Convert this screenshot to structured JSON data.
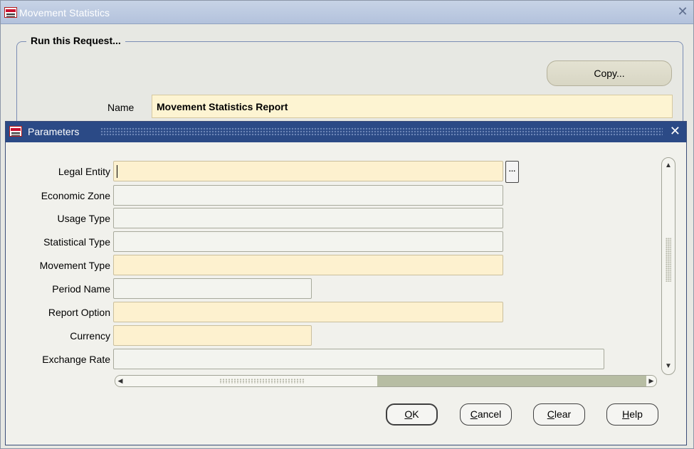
{
  "window": {
    "title": "Movement Statistics",
    "close_glyph": "✕"
  },
  "request": {
    "group_title": "Run this Request...",
    "copy_label": "Copy...",
    "name_label": "Name",
    "name_value": "Movement Statistics Report"
  },
  "parameters": {
    "title": "Parameters",
    "close_glyph": "✕",
    "fields": [
      {
        "label": "Legal Entity",
        "value": "",
        "required": true
      },
      {
        "label": "Economic Zone",
        "value": "",
        "required": false
      },
      {
        "label": "Usage Type",
        "value": "",
        "required": false
      },
      {
        "label": "Statistical Type",
        "value": "",
        "required": false
      },
      {
        "label": "Movement Type",
        "value": "",
        "required": true
      },
      {
        "label": "Period Name",
        "value": "",
        "required": false
      },
      {
        "label": "Report Option",
        "value": "",
        "required": true
      },
      {
        "label": "Currency",
        "value": "",
        "required": true
      },
      {
        "label": "Exchange Rate",
        "value": "",
        "required": false
      }
    ],
    "lov_glyph": "…",
    "buttons": {
      "ok": {
        "mnemonic": "O",
        "rest": "K"
      },
      "cancel": {
        "mnemonic": "C",
        "rest": "ancel"
      },
      "clear": {
        "mnemonic": "C",
        "rest": "lear",
        "prefix": ""
      },
      "help": {
        "mnemonic": "H",
        "rest": "elp"
      }
    }
  },
  "icons": {
    "logo": "oracle-logo-icon",
    "up": "▲",
    "down": "▼",
    "left": "◀",
    "right": "▶"
  },
  "colors": {
    "required_field": "#fdf1cf",
    "dialog_titlebar": "#2b4a86",
    "window_titlebar": "#b3c2dc"
  }
}
